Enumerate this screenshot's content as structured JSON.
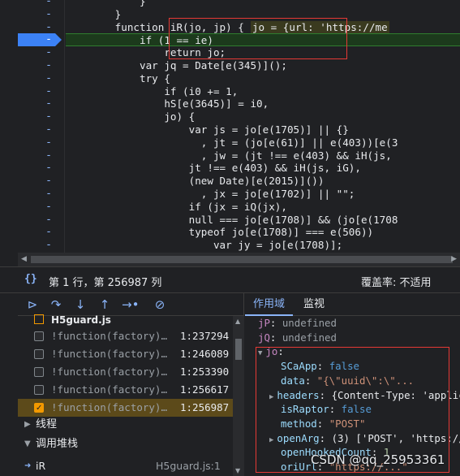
{
  "editor": {
    "code_lines": [
      {
        "text": "            }",
        "cls": ""
      },
      {
        "text": "        }",
        "cls": ""
      },
      {
        "text": "        function iR(jo, jp) {",
        "cls": "",
        "inline": "jo = {url: 'https://me"
      },
      {
        "text": "            if (1 == ie)",
        "cls": "hl"
      },
      {
        "text": "                return jo;",
        "cls": ""
      },
      {
        "text": "            var jq = Date[e(345)]();",
        "cls": ""
      },
      {
        "text": "            try {",
        "cls": ""
      },
      {
        "text": "                if (i0 += 1,",
        "cls": ""
      },
      {
        "text": "                hS[e(3645)] = i0,",
        "cls": ""
      },
      {
        "text": "                jo) {",
        "cls": ""
      },
      {
        "text": "                    var js = jo[e(1705)] || {}",
        "cls": ""
      },
      {
        "text": "                      , jt = (jo[e(61)] || e(403))[e(3",
        "cls": ""
      },
      {
        "text": "                      , jw = (jt !== e(403) && iH(js,",
        "cls": ""
      },
      {
        "text": "                    jt !== e(403) && iH(js, iG),",
        "cls": ""
      },
      {
        "text": "                    (new Date)[e(2015)]())",
        "cls": ""
      },
      {
        "text": "                      , jx = jo[e(1702)] || \"\";",
        "cls": ""
      },
      {
        "text": "                    if (jx = iQ(jx),",
        "cls": ""
      },
      {
        "text": "                    null === jo[e(1708)] && (jo[e(1708",
        "cls": ""
      },
      {
        "text": "                    typeof jo[e(1708)] === e(506))",
        "cls": ""
      },
      {
        "text": "                        var jy = jo[e(1708)];",
        "cls": ""
      }
    ]
  },
  "status": {
    "brace_icon": "{}",
    "position": "第 1 行，第 256987 列",
    "coverage": "覆盖率: 不适用"
  },
  "debugger": {
    "file": "H5guard.js",
    "frames": [
      {
        "text": "!function(factory)…",
        "loc": "1:237294",
        "selected": false
      },
      {
        "text": "!function(factory)…",
        "loc": "1:246089",
        "selected": false
      },
      {
        "text": "!function(factory)…",
        "loc": "1:253390",
        "selected": false
      },
      {
        "text": "!function(factory)…",
        "loc": "1:256617",
        "selected": false
      },
      {
        "text": "!function(factory)…",
        "loc": "1:256987",
        "selected": true
      }
    ],
    "threads_label": "线程",
    "callstack_label": "调用堆栈",
    "callstack_item": {
      "name": "iR",
      "file": "H5guard.js:1"
    }
  },
  "scope": {
    "tabs": [
      "作用域",
      "监视"
    ],
    "props": [
      {
        "key": "jP",
        "value": "undefined",
        "vtype": "undef",
        "indent": 0,
        "tri": ""
      },
      {
        "key": "jQ",
        "value": "undefined",
        "vtype": "undef",
        "indent": 0,
        "tri": ""
      },
      {
        "key": "jo",
        "value": "",
        "vtype": "",
        "indent": 0,
        "tri": "▼"
      },
      {
        "key": "SCaApp",
        "value": "false",
        "vtype": "kw",
        "indent": 1,
        "tri": ""
      },
      {
        "key": "data",
        "value": "\"{\\\"uuid\\\":\\\"...",
        "vtype": "str",
        "indent": 1,
        "tri": ""
      },
      {
        "key": "headers",
        "value": "{Content-Type: 'applic",
        "vtype": "plain",
        "indent": 1,
        "tri": "▶"
      },
      {
        "key": "isRaptor",
        "value": "false",
        "vtype": "kw",
        "indent": 1,
        "tri": ""
      },
      {
        "key": "method",
        "value": "\"POST\"",
        "vtype": "str",
        "indent": 1,
        "tri": ""
      },
      {
        "key": "openArg",
        "value": "(3) ['POST', 'https://",
        "vtype": "plain",
        "indent": 1,
        "tri": "▶"
      },
      {
        "key": "openHookedCount",
        "value": "1",
        "vtype": "num",
        "indent": 1,
        "tri": ""
      },
      {
        "key": "oriUrl",
        "value": "\"https://...\"",
        "vtype": "str",
        "indent": 1,
        "tri": ""
      }
    ]
  },
  "watermark": "CSDN @qq_25953361",
  "colors": {
    "breakpoint": "#3c82f6",
    "highlight_line": "#1c3a1c",
    "annotation": "#e53935",
    "selected_frame": "#5c4a1a"
  }
}
